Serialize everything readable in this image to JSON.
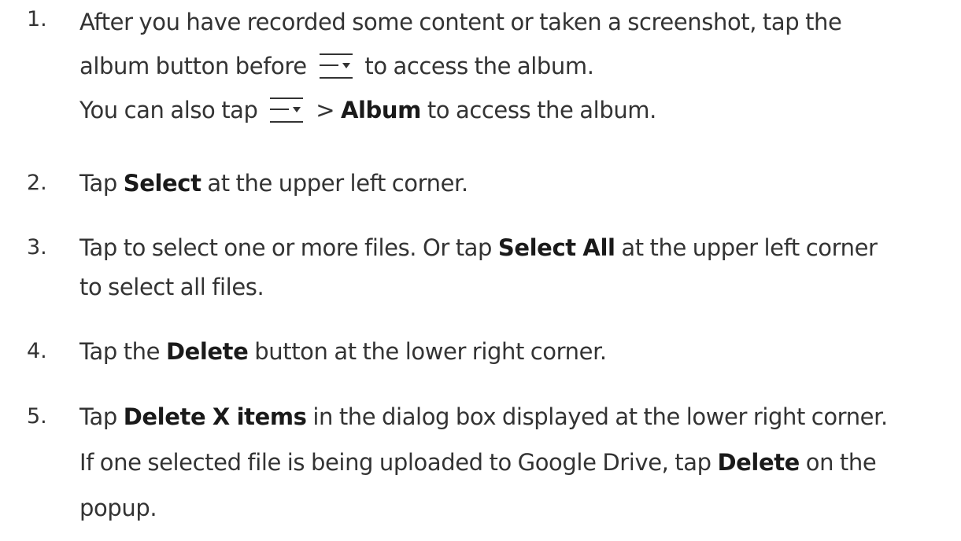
{
  "steps": [
    {
      "number": "1.",
      "lines": [
        {
          "t1": "After you have recorded some content or taken a screenshot, tap the"
        },
        {
          "t1": "album button before",
          "icon": "menu-dropdown-icon",
          "t2": "to access the album."
        },
        {
          "t1": "You can also tap",
          "icon": "menu-dropdown-icon",
          "t2": ">",
          "bold": "Album",
          "t3": "to access the album."
        }
      ]
    },
    {
      "number": "2.",
      "lines": [
        {
          "t1": "Tap",
          "bold": "Select",
          "t2": "at the upper left corner."
        }
      ]
    },
    {
      "number": "3.",
      "lines": [
        {
          "t1": "Tap to select one or more files. Or tap",
          "bold": "Select All",
          "t2": "at the upper left corner"
        },
        {
          "t1": "to select all files."
        }
      ]
    },
    {
      "number": "4.",
      "lines": [
        {
          "t1": "Tap the",
          "bold": "Delete",
          "t2": "button at the lower right corner."
        }
      ]
    },
    {
      "number": "5.",
      "lines": [
        {
          "t1": "Tap",
          "bold": "Delete X items",
          "t2": "in the dialog box displayed at the lower right corner."
        },
        {
          "t1": "If one selected file is being uploaded to Google Drive, tap",
          "bold": "Delete",
          "t2": "on the"
        },
        {
          "t1": "popup."
        }
      ]
    }
  ]
}
